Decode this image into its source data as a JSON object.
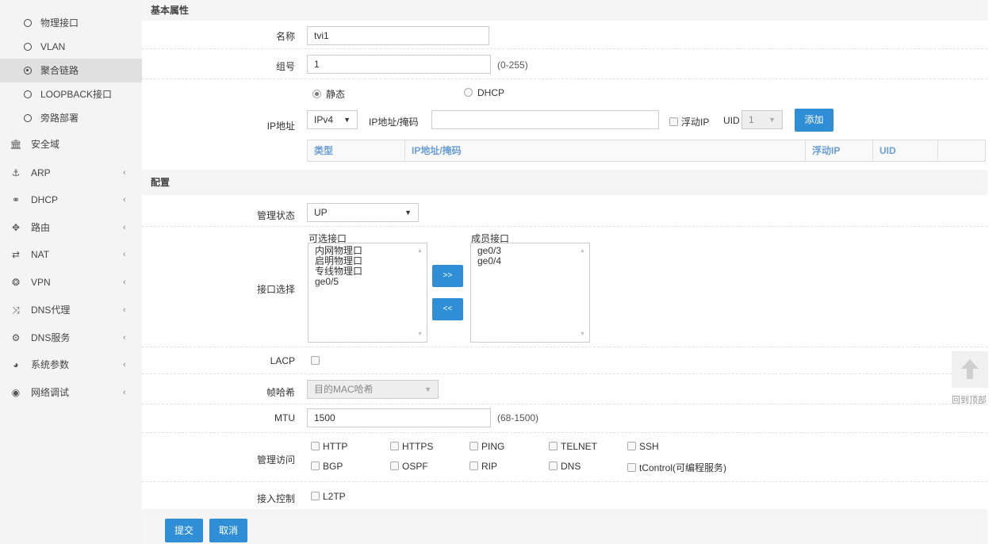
{
  "sidebar": {
    "sub_items": [
      {
        "label": "物理接口",
        "active": false
      },
      {
        "label": "VLAN",
        "active": false
      },
      {
        "label": "聚合链路",
        "active": true
      },
      {
        "label": "LOOPBACK接口",
        "active": false
      },
      {
        "label": "旁路部署",
        "active": false
      }
    ],
    "menu_items": [
      {
        "label": "安全域",
        "icon": "bank-icon",
        "glyph": "🏛",
        "has_chevron": false
      },
      {
        "label": "ARP",
        "icon": "anchor-icon",
        "glyph": "⚓",
        "has_chevron": true
      },
      {
        "label": "DHCP",
        "icon": "network-icon",
        "glyph": "⚭",
        "has_chevron": true
      },
      {
        "label": "路由",
        "icon": "arrows-icon",
        "glyph": "✥",
        "has_chevron": true
      },
      {
        "label": "NAT",
        "icon": "exchange-icon",
        "glyph": "⇄",
        "has_chevron": true
      },
      {
        "label": "VPN",
        "icon": "vpn-icon",
        "glyph": "❂",
        "has_chevron": true
      },
      {
        "label": "DNS代理",
        "icon": "shuffle-icon",
        "glyph": "⤨",
        "has_chevron": true
      },
      {
        "label": "DNS服务",
        "icon": "cogs-icon",
        "glyph": "⚙",
        "has_chevron": true
      },
      {
        "label": "系统参数",
        "icon": "globe-icon",
        "glyph": "◕",
        "has_chevron": true
      },
      {
        "label": "网络调试",
        "icon": "bullseye-icon",
        "glyph": "◉",
        "has_chevron": true
      }
    ],
    "chevron": "‹"
  },
  "basic": {
    "section_title": "基本属性",
    "name_label": "名称",
    "name_value": "tvi1",
    "group_label": "组号",
    "group_value": "1",
    "group_hint": "(0-255)",
    "ip_label": "IP地址",
    "ip_mode_static": "静态",
    "ip_mode_dhcp": "DHCP",
    "ip_mode_selected": "静态",
    "ip_version": "IPv4",
    "ip_mask_label": "IP地址/掩码",
    "ip_mask_value": "",
    "float_ip_label": "浮动IP",
    "uid_label": "UID",
    "uid_value": "1",
    "add_button": "添加",
    "table_headers": [
      "类型",
      "IP地址/掩码",
      "浮动IP",
      "UID"
    ]
  },
  "config": {
    "section_title": "配置",
    "admin_state_label": "管理状态",
    "admin_state_value": "UP",
    "iface_select_label": "接口选择",
    "available_title": "可选接口",
    "available": [
      "内网物理口",
      "启明物理口",
      "专线物理口",
      "ge0/5"
    ],
    "member_title": "成员接口",
    "members": [
      "ge0/3",
      "ge0/4"
    ],
    "move_right": ">>",
    "move_left": "<<",
    "lacp_label": "LACP",
    "lacp_checked": false,
    "hash_label": "帧哈希",
    "hash_value": "目的MAC哈希",
    "mtu_label": "MTU",
    "mtu_value": "1500",
    "mtu_hint": "(68-1500)",
    "mgmt_label": "管理访问",
    "mgmt_row1": [
      "HTTP",
      "HTTPS",
      "PING",
      "TELNET",
      "SSH"
    ],
    "mgmt_row2": [
      "BGP",
      "OSPF",
      "RIP",
      "DNS",
      "tControl(可编程服务)"
    ],
    "access_label": "接入控制",
    "access_options": [
      "L2TP"
    ]
  },
  "footer": {
    "submit": "提交",
    "cancel": "取消"
  },
  "back_to_top": {
    "label": "回到顶部",
    "icon": "arrow-up-icon"
  },
  "colors": {
    "primary_button": "#2f8ed6",
    "table_header_text": "#6a9ed6",
    "sidebar_bg": "#f4f4f4"
  }
}
